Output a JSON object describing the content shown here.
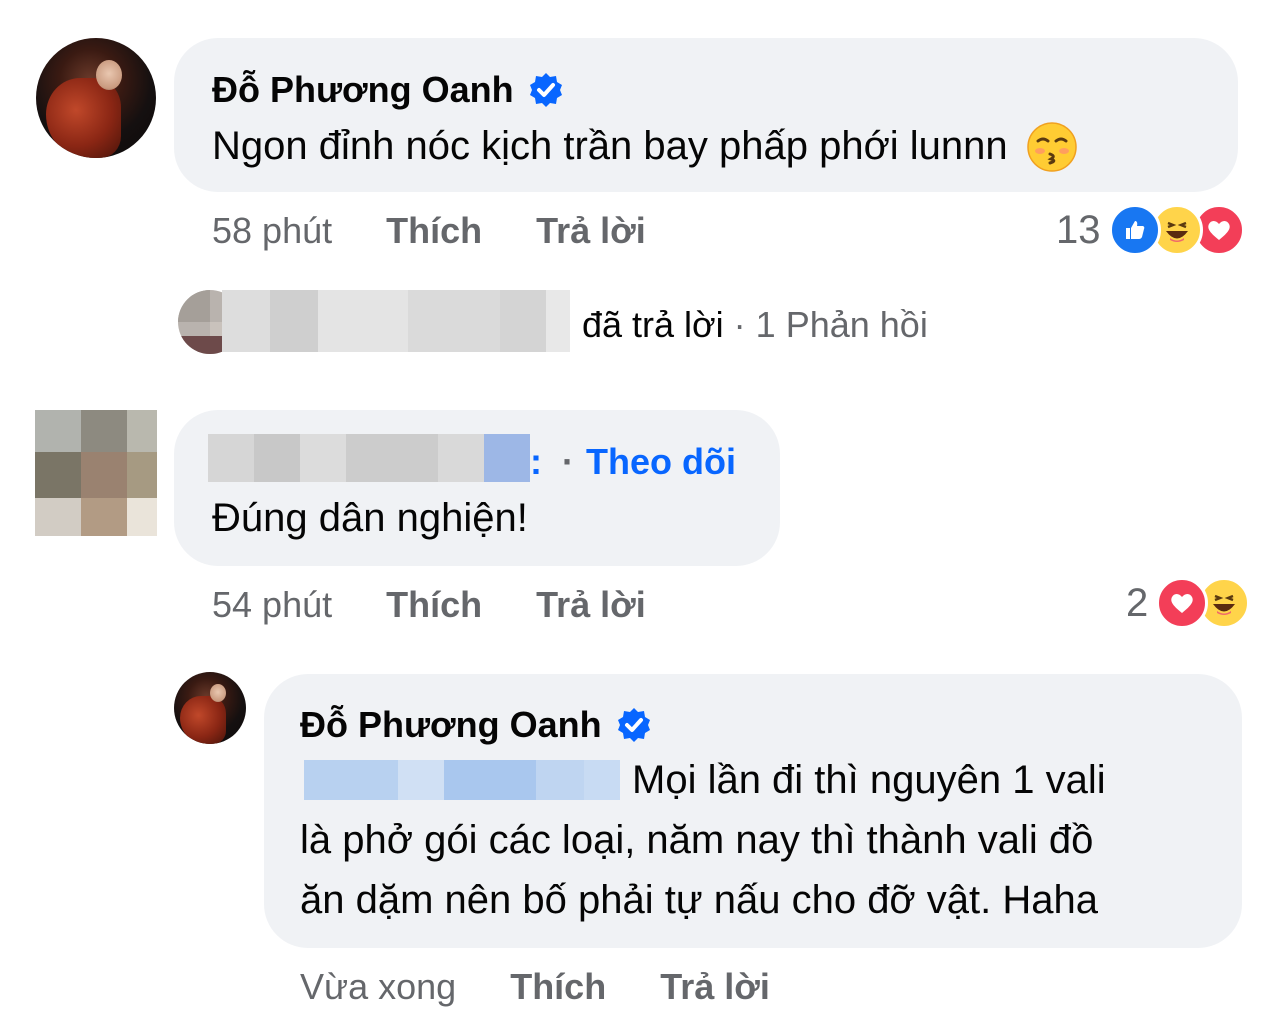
{
  "comments": [
    {
      "author": "Đỗ Phương Oanh",
      "text": "Ngon đỉnh nóc kịch trần bay phấp phới lunnn",
      "time": "58 phút",
      "like_label": "Thích",
      "reply_label": "Trả lời",
      "reaction_count": "13",
      "reactions": [
        "like-icon",
        "haha-icon",
        "love-icon"
      ]
    },
    {
      "follow_label": "Theo dõi",
      "text": "Đúng dân nghiện!",
      "time": "54 phút",
      "like_label": "Thích",
      "reply_label": "Trả lời",
      "reaction_count": "2",
      "reactions": [
        "love-icon",
        "haha-icon"
      ]
    }
  ],
  "reply_summary": {
    "replied_label": "đã trả lời",
    "separator": "·",
    "count_label": "1 Phản hồi"
  },
  "reply": {
    "author": "Đỗ Phương Oanh",
    "line1": "Mọi lần đi thì nguyên 1 vali",
    "line2": "là phở gói các loại, năm nay thì thành vali đồ",
    "line3": "ăn dặm nên bố phải tự nấu cho đỡ vật. Haha",
    "time": "Vừa xong",
    "like_label": "Thích",
    "reply_label": "Trả lời"
  },
  "colors": {
    "bubble": "#f0f2f5",
    "link_blue": "#0866ff",
    "meta_gray": "#65676b"
  }
}
